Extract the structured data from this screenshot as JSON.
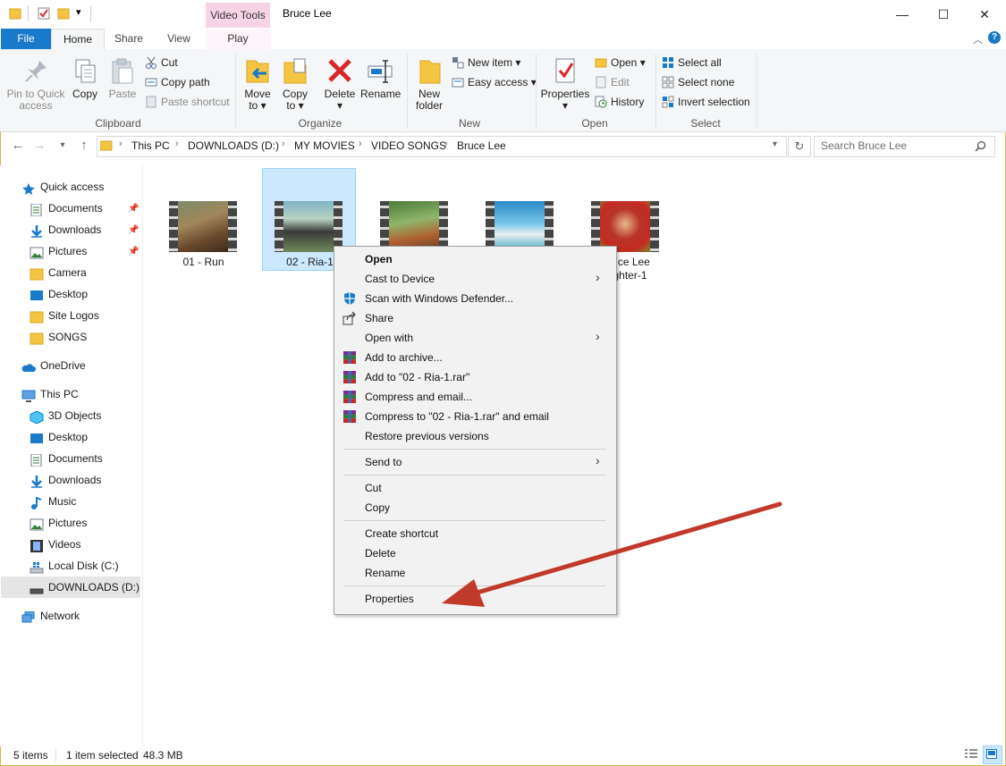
{
  "window": {
    "title": "Bruce Lee",
    "contextual_tab_group": "Video Tools",
    "controls": {
      "minimize": "—",
      "maximize": "☐",
      "close": "✕"
    }
  },
  "tabs": {
    "file": "File",
    "home": "Home",
    "share": "Share",
    "view": "View",
    "play": "Play"
  },
  "ribbon": {
    "clipboard": {
      "pin_line1": "Pin to Quick",
      "pin_line2": "access",
      "copy": "Copy",
      "paste": "Paste",
      "cut": "Cut",
      "copy_path": "Copy path",
      "paste_shortcut": "Paste shortcut",
      "label": "Clipboard"
    },
    "organize": {
      "move_line1": "Move",
      "move_line2": "to ▾",
      "copy_line1": "Copy",
      "copy_line2": "to ▾",
      "delete_line1": "Delete",
      "delete_line2": "▾",
      "rename": "Rename",
      "label": "Organize"
    },
    "new": {
      "new_folder_line1": "New",
      "new_folder_line2": "folder",
      "new_item": "New item ▾",
      "easy_access": "Easy access ▾",
      "label": "New"
    },
    "open": {
      "properties_line1": "Properties",
      "properties_line2": "▾",
      "open": "Open ▾",
      "edit": "Edit",
      "history": "History",
      "label": "Open"
    },
    "select": {
      "select_all": "Select all",
      "select_none": "Select none",
      "invert_selection": "Invert selection",
      "label": "Select"
    }
  },
  "address": {
    "crumbs": [
      "This PC",
      "DOWNLOADS (D:)",
      "MY MOVIES",
      "VIDEO SONGS",
      "Bruce Lee"
    ],
    "search_placeholder": "Search Bruce Lee"
  },
  "nav": {
    "quick_access": "Quick access",
    "quick_items": [
      "Documents",
      "Downloads",
      "Pictures",
      "Camera",
      "Desktop",
      "Site Logos",
      "SONGS"
    ],
    "onedrive": "OneDrive",
    "this_pc": "This PC",
    "pc_items": [
      "3D Objects",
      "Desktop",
      "Documents",
      "Downloads",
      "Music",
      "Pictures",
      "Videos",
      "Local Disk (C:)",
      "DOWNLOADS (D:)"
    ],
    "network": "Network"
  },
  "files": [
    {
      "name": "01 - Run"
    },
    {
      "name": "02 - Ria-1"
    },
    {
      "name": ""
    },
    {
      "name": ""
    },
    {
      "name_line1": "Bruce Lee",
      "name_line2": "Fighter-1"
    }
  ],
  "context_menu": {
    "open": "Open",
    "cast": "Cast to Device",
    "scan": "Scan with Windows Defender...",
    "share": "Share",
    "open_with": "Open with",
    "add_archive": "Add to archive...",
    "add_rar": "Add to \"02 - Ria-1.rar\"",
    "compress_email": "Compress and email...",
    "compress_rar_email": "Compress to \"02 - Ria-1.rar\" and email",
    "restore": "Restore previous versions",
    "send_to": "Send to",
    "cut": "Cut",
    "copy": "Copy",
    "create_shortcut": "Create shortcut",
    "delete": "Delete",
    "rename": "Rename",
    "properties": "Properties"
  },
  "status": {
    "items": "5 items",
    "selected": "1 item selected",
    "size": "48.3 MB"
  },
  "colors": {
    "file_tab": "#1979ca",
    "selection": "#cce8ff",
    "annotation_arrow": "#c0392b"
  }
}
